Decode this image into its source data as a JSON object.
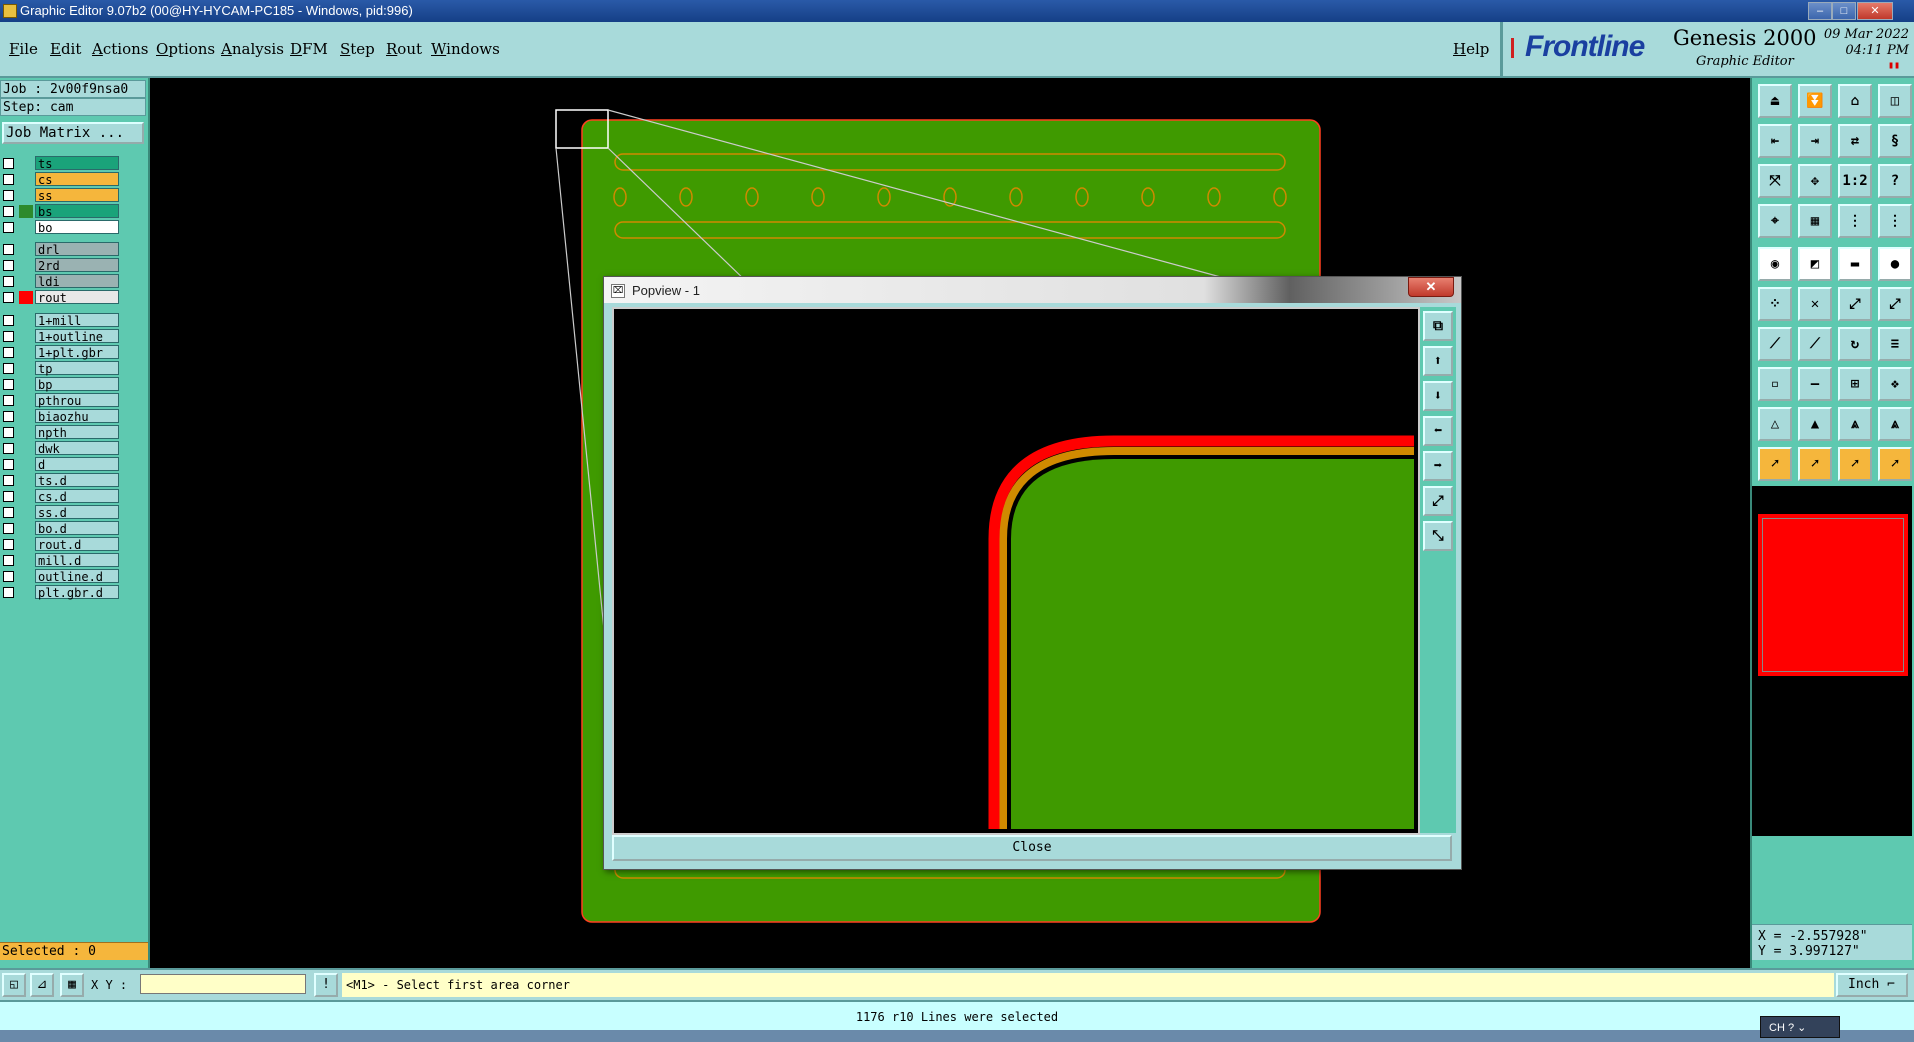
{
  "window": {
    "title": "Graphic Editor 9.07b2 (00@HY-HYCAM-PC185 - Windows, pid:996)",
    "min": "–",
    "max": "□",
    "close": "✕"
  },
  "menu": [
    "File",
    "Edit",
    "Actions",
    "Options",
    "Analysis",
    "DFM",
    "Step",
    "Rout",
    "Windows"
  ],
  "help": "Help",
  "brand": {
    "logo": "Frontline",
    "product": "Genesis 2000",
    "subtitle": "Graphic Editor",
    "date": "09 Mar 2022",
    "time": "04:11 PM"
  },
  "job": {
    "job_line": "Job : 2v00f9nsa0",
    "step_line": "Step: cam",
    "matrix_button": "Job Matrix ..."
  },
  "layers": [
    {
      "name": "ts",
      "bg": "#1aa37a",
      "swatch": ""
    },
    {
      "name": "cs",
      "bg": "#f5b63c",
      "swatch": ""
    },
    {
      "name": "ss",
      "bg": "#f5b63c",
      "swatch": ""
    },
    {
      "name": "bs",
      "bg": "#1aa37a",
      "swatch": "#2d8a2d"
    },
    {
      "name": "bo",
      "bg": "#ffffff",
      "swatch": ""
    },
    {
      "name": "drl",
      "bg": "#9ab2b2",
      "swatch": ""
    },
    {
      "name": "2rd",
      "bg": "#9ab2b2",
      "swatch": ""
    },
    {
      "name": "ldi",
      "bg": "#9ab2b2",
      "swatch": ""
    },
    {
      "name": "rout",
      "bg": "#e8e8e8",
      "swatch": "#ff0000"
    },
    {
      "name": "1+mill",
      "bg": "#a8dada",
      "swatch": ""
    },
    {
      "name": "1+outline",
      "bg": "#a8dada",
      "swatch": ""
    },
    {
      "name": "1+plt.gbr",
      "bg": "#a8dada",
      "swatch": ""
    },
    {
      "name": "tp",
      "bg": "#a8dada",
      "swatch": ""
    },
    {
      "name": "bp",
      "bg": "#a8dada",
      "swatch": ""
    },
    {
      "name": "pthrou",
      "bg": "#a8dada",
      "swatch": ""
    },
    {
      "name": "biaozhu",
      "bg": "#a8dada",
      "swatch": ""
    },
    {
      "name": "npth",
      "bg": "#a8dada",
      "swatch": ""
    },
    {
      "name": "dwk",
      "bg": "#a8dada",
      "swatch": ""
    },
    {
      "name": "d",
      "bg": "#a8dada",
      "swatch": ""
    },
    {
      "name": "ts.d",
      "bg": "#a8dada",
      "swatch": ""
    },
    {
      "name": "cs.d",
      "bg": "#a8dada",
      "swatch": ""
    },
    {
      "name": "ss.d",
      "bg": "#a8dada",
      "swatch": ""
    },
    {
      "name": "bo.d",
      "bg": "#a8dada",
      "swatch": ""
    },
    {
      "name": "rout.d",
      "bg": "#a8dada",
      "swatch": ""
    },
    {
      "name": "mill.d",
      "bg": "#a8dada",
      "swatch": ""
    },
    {
      "name": "outline.d",
      "bg": "#a8dada",
      "swatch": ""
    },
    {
      "name": "plt.gbr.d",
      "bg": "#a8dada",
      "swatch": ""
    }
  ],
  "selected": "Selected : 0",
  "toolbar_labels": {
    "ratio": "1:2",
    "help": "?"
  },
  "coords": {
    "x": "X = -2.557928\"",
    "y": "Y = 3.997127\""
  },
  "cmd": {
    "xy_label": "X Y :",
    "xy_value": "",
    "bang": "!",
    "prompt": "<M1> - Select first area corner",
    "unit": "Inch ⌐"
  },
  "status": "1176 r10 Lines were selected",
  "ime": "CH ? ⌄",
  "popview": {
    "title": "Popview - 1",
    "close_x": "✕",
    "close_button": "Close"
  },
  "colors": {
    "board": "#3f9a00",
    "rout": "#ff0000",
    "outline": "#d08a00",
    "panel": "#a8dada",
    "side": "#5ec9b0"
  }
}
